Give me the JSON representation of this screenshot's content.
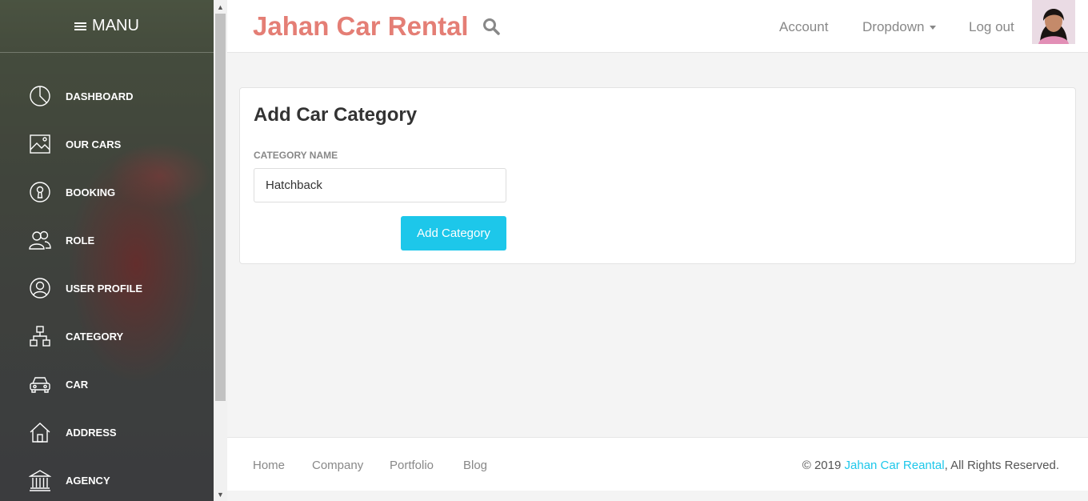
{
  "sidebar": {
    "header": "MANU",
    "items": [
      {
        "label": "DASHBOARD",
        "icon": "pie-chart-icon"
      },
      {
        "label": "OUR CARS",
        "icon": "image-icon"
      },
      {
        "label": "BOOKING",
        "icon": "keyhole-icon"
      },
      {
        "label": "ROLE",
        "icon": "users-icon"
      },
      {
        "label": "USER PROFILE",
        "icon": "user-circle-icon"
      },
      {
        "label": "CATEGORY",
        "icon": "hierarchy-icon"
      },
      {
        "label": "CAR",
        "icon": "car-icon"
      },
      {
        "label": "ADDRESS",
        "icon": "home-icon"
      },
      {
        "label": "AGENCY",
        "icon": "bank-icon"
      }
    ]
  },
  "topbar": {
    "brand": "Jahan Car Rental",
    "links": {
      "account": "Account",
      "dropdown": "Dropdown",
      "logout": "Log out"
    }
  },
  "card": {
    "title": "Add Car Category",
    "field_label": "CATEGORY NAME",
    "field_value": "Hatchback",
    "button": "Add Category"
  },
  "footer": {
    "links": [
      "Home",
      "Company",
      "Portfolio",
      "Blog"
    ],
    "copyright_prefix": "© 2019 ",
    "copyright_brand": "Jahan Car Reantal",
    "copyright_suffix": ", All Rights Reserved."
  },
  "colors": {
    "brand": "#e47e75",
    "accent": "#1dc7ea"
  }
}
